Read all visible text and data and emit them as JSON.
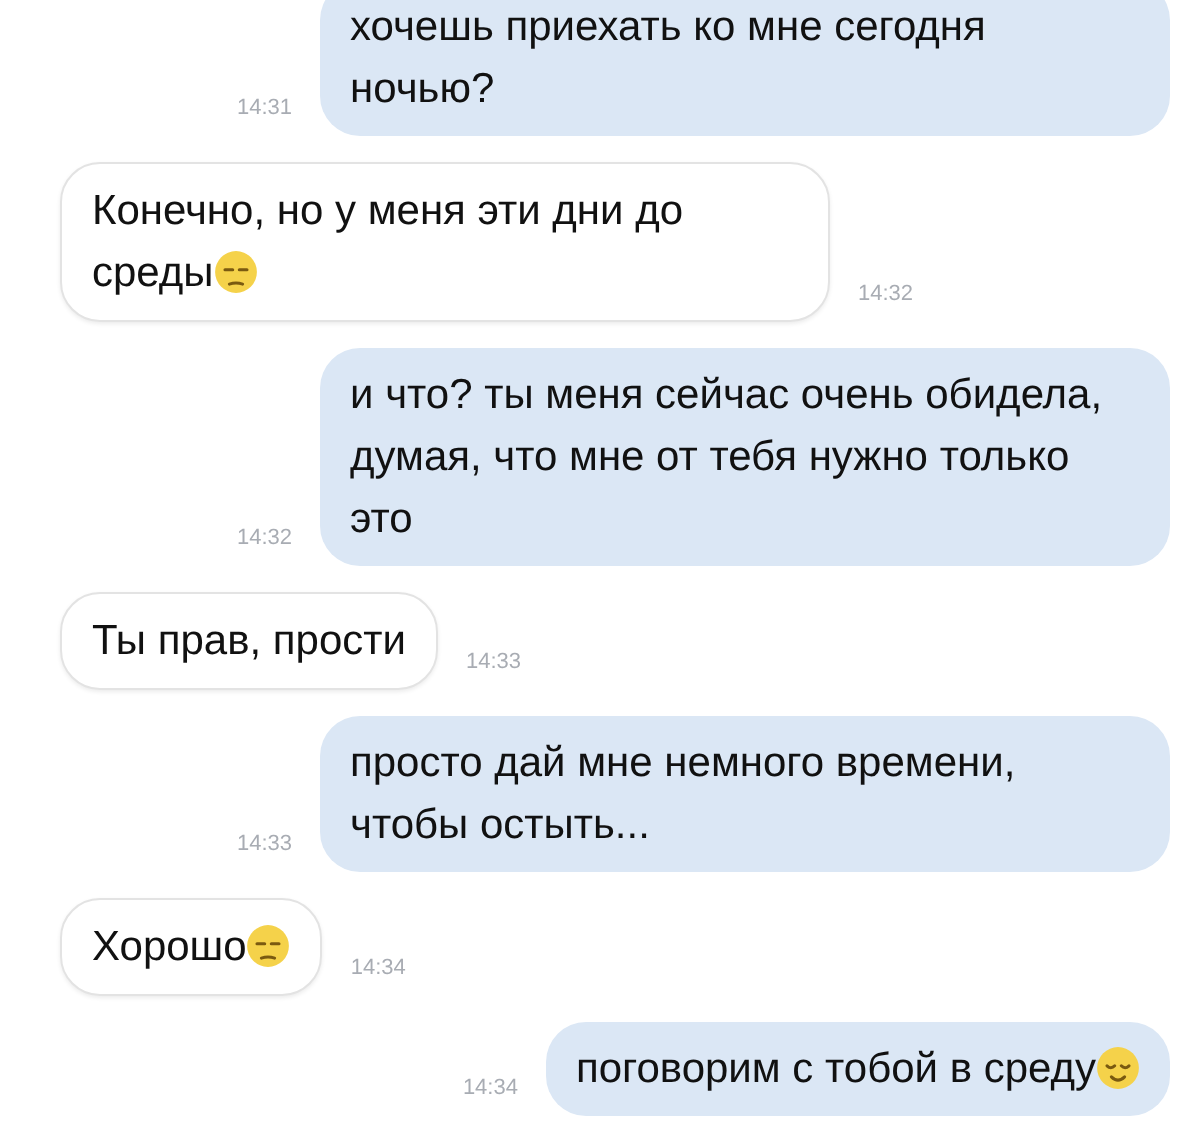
{
  "messages": [
    {
      "kind": "outgoing",
      "text": "хочешь приехать ко мне сегодня ночью?",
      "time": "14:31"
    },
    {
      "kind": "incoming",
      "text": "Конечно, но у меня эти дни до среды",
      "emoji": {
        "kind": "unamused"
      },
      "time": "14:32"
    },
    {
      "kind": "outgoing",
      "text": "и что? ты меня сейчас очень обидела, думая, что мне от тебя нужно только это",
      "time": "14:32"
    },
    {
      "kind": "incoming",
      "text": "Ты прав, прости",
      "time": "14:33"
    },
    {
      "kind": "outgoing",
      "text": "просто дай мне немного времени, чтобы остыть...",
      "time": "14:33"
    },
    {
      "kind": "incoming",
      "text": "Хорошо",
      "emoji": {
        "kind": "unamused"
      },
      "time": "14:34"
    },
    {
      "kind": "outgoing",
      "text": "поговорим с тобой в среду",
      "emoji": {
        "kind": "relieved"
      },
      "time": "14:34"
    }
  ]
}
